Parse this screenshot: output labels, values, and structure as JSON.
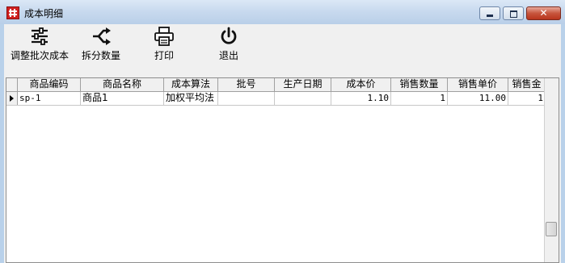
{
  "window": {
    "title": "成本明细",
    "icon": "app-grid-icon",
    "controls": [
      "minimize-icon",
      "maximize-icon",
      "close-icon"
    ],
    "close_glyph": "✕"
  },
  "toolbar": {
    "adjust_cost_label": "调整批次成本",
    "adjust_cost_icon": "sliders-icon",
    "split_qty_label": "拆分数量",
    "split_qty_icon": "split-arrows-icon",
    "print_label": "打印",
    "print_icon": "printer-icon",
    "exit_label": "退出",
    "exit_icon": "power-icon"
  },
  "grid": {
    "columns": [
      "商品编码",
      "商品名称",
      "成本算法",
      "批号",
      "生产日期",
      "成本价",
      "销售数量",
      "销售单价",
      "销售金"
    ],
    "rows": [
      {
        "code": "sp-1",
        "name": "商品1",
        "method": "加权平均法",
        "batch": "",
        "date": "",
        "cost": "1.10",
        "qty": "1",
        "price": "11.00",
        "amount": "1"
      }
    ]
  },
  "colors": {
    "title_bar": "#c7d9ee",
    "window_frame": "#b9d1ea",
    "close_button": "#c7553d",
    "app_icon": "#d02020"
  }
}
